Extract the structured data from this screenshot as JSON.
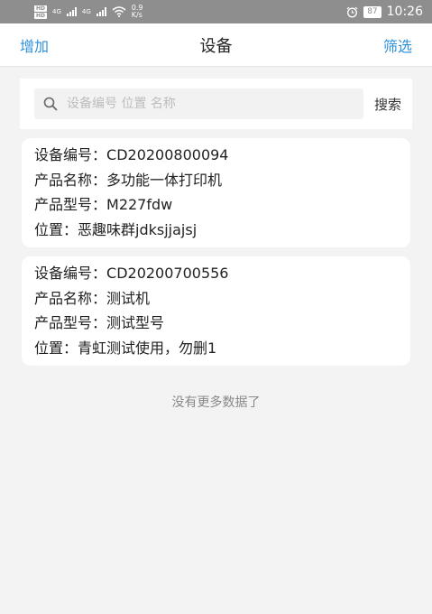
{
  "status_bar": {
    "hd1": "HD",
    "hd2": "HD",
    "net1": "4G",
    "net2": "4G",
    "speed_value": "0.9",
    "speed_unit": "K/s",
    "battery": "87",
    "time": "10:26"
  },
  "header": {
    "left": "增加",
    "title": "设备",
    "right": "筛选"
  },
  "search": {
    "placeholder": "设备编号 位置 名称",
    "button": "搜索"
  },
  "devices": [
    {
      "code_label": "设备编号：",
      "code": "CD20200800094",
      "name_label": "产品名称：",
      "name": "多功能一体打印机",
      "model_label": "产品型号：",
      "model": "M227fdw",
      "location_label": "位置：",
      "location": "恶趣味群jdksjjajsj"
    },
    {
      "code_label": "设备编号：",
      "code": "CD20200700556",
      "name_label": "产品名称：",
      "name": "测试机",
      "model_label": "产品型号：",
      "model": "测试型号",
      "location_label": "位置：",
      "location": "青虹测试使用，勿删1"
    }
  ],
  "footer": {
    "no_more": "没有更多数据了"
  },
  "colors": {
    "accent": "#2f8fd8",
    "status_bar": "#8e8e8e",
    "background": "#f3f3f3"
  }
}
